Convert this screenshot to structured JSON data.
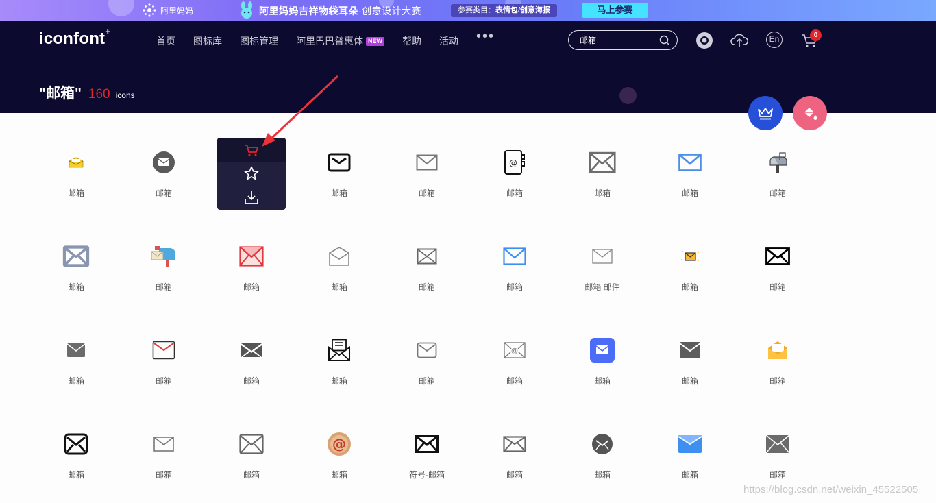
{
  "promo": {
    "ali_label": "阿里妈妈",
    "title": "阿里妈妈吉祥物袋耳朵",
    "title_sub": "-创意设计大赛",
    "category_label": "参赛类目：",
    "category_value": "表情包/创意海报",
    "cta": "马上参赛"
  },
  "header": {
    "logo": "iconfont",
    "logo_sup": "+",
    "nav": [
      {
        "label": "首页"
      },
      {
        "label": "图标库"
      },
      {
        "label": "图标管理"
      },
      {
        "label": "阿里巴巴普惠体",
        "badge": "NEW"
      },
      {
        "label": "帮助"
      },
      {
        "label": "活动"
      }
    ],
    "more": "•••",
    "search_value": "邮箱",
    "lang": "En",
    "cart_count": "0"
  },
  "result": {
    "query": "\"邮箱\"",
    "count": "160",
    "unit": "icons"
  },
  "icons": [
    {
      "label": "邮箱",
      "icon": "small-open-envelope-yellow"
    },
    {
      "label": "邮箱",
      "icon": "round-envelope-grey"
    },
    {
      "label": "邮箱",
      "icon": "envelope-hovered"
    },
    {
      "label": "邮箱",
      "icon": "envelope-bold-black"
    },
    {
      "label": "邮箱",
      "icon": "envelope-thin-grey"
    },
    {
      "label": "邮箱",
      "icon": "address-book-at"
    },
    {
      "label": "邮箱",
      "icon": "envelope-large-grey"
    },
    {
      "label": "邮箱",
      "icon": "envelope-blue-outline"
    },
    {
      "label": "邮箱",
      "icon": "mailbox-post"
    },
    {
      "label": "邮箱",
      "icon": "envelope-slate-filled"
    },
    {
      "label": "邮箱",
      "icon": "mailbox-colored"
    },
    {
      "label": "邮箱",
      "icon": "envelope-red-pink"
    },
    {
      "label": "邮箱",
      "icon": "envelope-open-outline"
    },
    {
      "label": "邮箱",
      "icon": "envelope-x-grey"
    },
    {
      "label": "邮箱",
      "icon": "envelope-blue-thin"
    },
    {
      "label": "邮箱 邮件",
      "icon": "envelope-thin-light"
    },
    {
      "label": "邮箱",
      "icon": "envelope-orange-sparkle"
    },
    {
      "label": "邮箱",
      "icon": "envelope-black-bold"
    },
    {
      "label": "邮箱",
      "icon": "envelope-filled-grey"
    },
    {
      "label": "邮箱",
      "icon": "envelope-red-outline"
    },
    {
      "label": "邮箱",
      "icon": "envelope-filled-dark"
    },
    {
      "label": "邮箱",
      "icon": "envelope-letter-open"
    },
    {
      "label": "邮箱",
      "icon": "envelope-thin-grey-2"
    },
    {
      "label": "邮箱",
      "icon": "envelope-at"
    },
    {
      "label": "邮箱",
      "icon": "envelope-blue-square"
    },
    {
      "label": "邮箱",
      "icon": "envelope-filled-dark-2"
    },
    {
      "label": "邮箱",
      "icon": "envelope-open-yellow"
    },
    {
      "label": "邮箱",
      "icon": "envelope-rounded-black"
    },
    {
      "label": "邮箱",
      "icon": "envelope-thin-grey-3"
    },
    {
      "label": "邮箱",
      "icon": "envelope-outline-grey"
    },
    {
      "label": "邮箱",
      "icon": "at-sign-brown"
    },
    {
      "label": "符号-邮箱",
      "icon": "envelope-bold-black-2"
    },
    {
      "label": "邮箱",
      "icon": "envelope-x-grey-2"
    },
    {
      "label": "邮箱",
      "icon": "round-envelope-dark"
    },
    {
      "label": "邮箱",
      "icon": "envelope-blue-filled"
    },
    {
      "label": "邮箱",
      "icon": "envelope-filled-grey-2"
    }
  ],
  "watermark": "https://blog.csdn.net/weixin_45522505",
  "colors": {
    "header_bg": "#0c0a2e",
    "accent_red": "#e3242b",
    "crown_fab": "#2650d8",
    "paint_fab": "#ee6480"
  }
}
